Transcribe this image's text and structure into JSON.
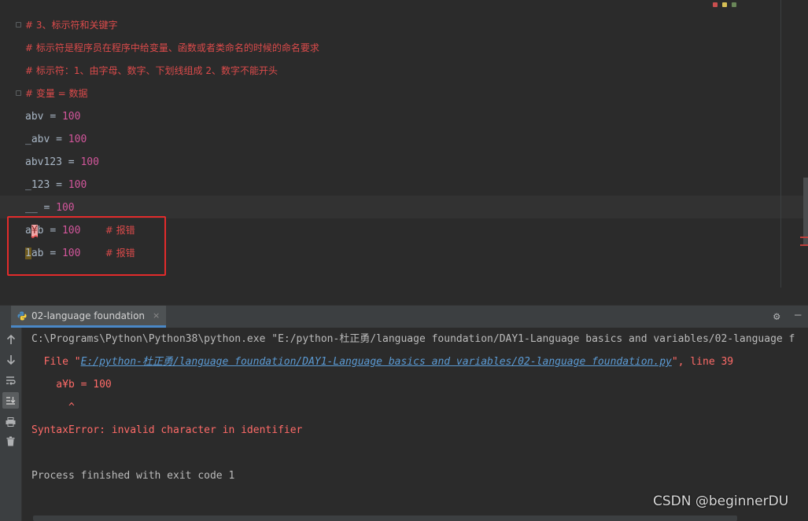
{
  "editor": {
    "lines": [
      {
        "kind": "comment",
        "text": "# 3、标示符和关键字"
      },
      {
        "kind": "comment",
        "text": "# 标示符是程序员在程序中给变量、函数或者类命名的时候的命名要求"
      },
      {
        "kind": "comment",
        "text": "# 标示符：1、由字母、数字、下划线组成 2、数字不能开头"
      },
      {
        "kind": "comment",
        "text": "# 变量 = 数据"
      }
    ],
    "assignments": [
      {
        "name": "abv",
        "op": "=",
        "value": "100"
      },
      {
        "name": "_abv",
        "op": "=",
        "value": "100"
      },
      {
        "name": "abv123",
        "op": "=",
        "value": "100"
      },
      {
        "name": "_123",
        "op": "=",
        "value": "100"
      },
      {
        "name": "__",
        "op": "=",
        "value": "100"
      }
    ],
    "bad_lines": [
      {
        "pre": "a",
        "bad": "¥",
        "post": "b",
        "op": "=",
        "value": "100",
        "comment": "# 报错"
      },
      {
        "pre": "",
        "bad": "1",
        "post": "ab",
        "op": "=",
        "value": "100",
        "comment": "# 报错"
      }
    ]
  },
  "run_panel": {
    "tab_label": "02-language foundation",
    "tab_close": "×",
    "console": {
      "command": "C:\\Programs\\Python\\Python38\\python.exe \"E:/python-杜正勇/language foundation/DAY1-Language basics and variables/02-language f",
      "file_prefix": "  File \"",
      "file_link": "E:/python-杜正勇/language foundation/DAY1-Language basics and variables/02-language foundation.py",
      "file_suffix": "\", line 39",
      "source_line": "    a¥b = 100",
      "caret": "      ^",
      "error": "SyntaxError: invalid character in identifier",
      "exit": "Process finished with exit code 1"
    }
  },
  "icons": {
    "tools": [
      "up-arrow-icon",
      "down-arrow-icon",
      "soft-wrap-icon",
      "scroll-to-end-icon",
      "print-icon",
      "trash-icon"
    ]
  },
  "watermark": "CSDN @beginnerDU",
  "colors": {
    "comment": "#dc4b4b",
    "number": "#d2569b",
    "highlight_box": "#e22b2b",
    "link": "#5b9bd5",
    "error": "#ff6b68"
  }
}
